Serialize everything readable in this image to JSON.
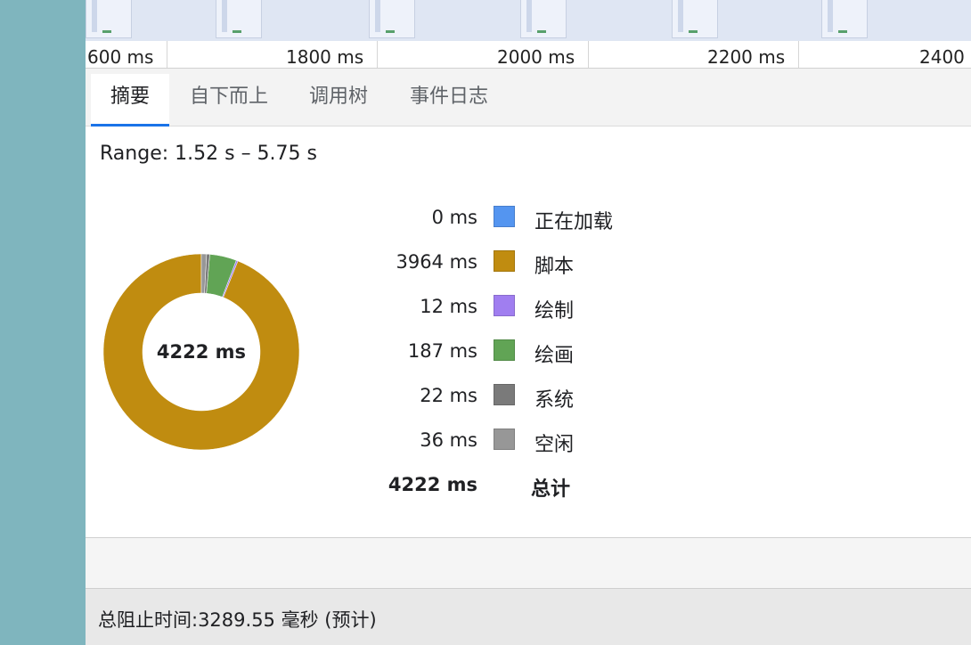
{
  "ruler": {
    "ticks": [
      "600 ms",
      "1800 ms",
      "2000 ms",
      "2200 ms",
      "2400"
    ]
  },
  "tabs": [
    {
      "label": "摘要",
      "active": true
    },
    {
      "label": "自下而上",
      "active": false
    },
    {
      "label": "调用树",
      "active": false
    },
    {
      "label": "事件日志",
      "active": false
    }
  ],
  "summary": {
    "range": "Range: 1.52 s – 5.75 s",
    "total_center": "4222 ms",
    "legend": [
      {
        "value": "0 ms",
        "label": "正在加载",
        "color": "#5495f0",
        "ms": 0
      },
      {
        "value": "3964 ms",
        "label": "脚本",
        "color": "#c08c10",
        "ms": 3964
      },
      {
        "value": "12 ms",
        "label": "绘制",
        "color": "#a07ef0",
        "ms": 12
      },
      {
        "value": "187 ms",
        "label": "绘画",
        "color": "#61a455",
        "ms": 187
      },
      {
        "value": "22 ms",
        "label": "系统",
        "color": "#7a7a7a",
        "ms": 22
      },
      {
        "value": "36 ms",
        "label": "空闲",
        "color": "#979797",
        "ms": 36
      }
    ],
    "total": {
      "value": "4222 ms",
      "label": "总计"
    }
  },
  "status": {
    "text": "总阻止时间:3289.55 毫秒 (预计)"
  }
}
